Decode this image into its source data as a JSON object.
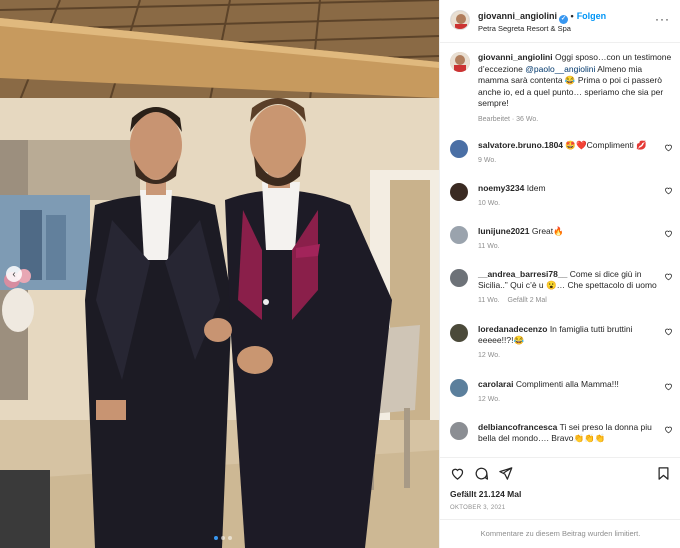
{
  "post": {
    "username": "giovanni_angiolini",
    "follow_label": "Folgen",
    "location": "Petra Segreta Resort & Spa",
    "more_icon": "more-options-icon",
    "caption": {
      "username": "giovanni_angiolini",
      "text_1": "Oggi sposo…con un testimone d’eccezione",
      "mention": "@paolo__angiolini",
      "text_2": "Almeno mia mamma sarà contenta 😂 Prima o poi ci passerò anche io, ed a quel punto… speriamo che sia per sempre!",
      "meta": "Bearbeitet · 36 Wo."
    },
    "comments": [
      {
        "username": "salvatore.bruno.1804",
        "text": "🤩❤️Complimenti 💋",
        "meta": "9 Wo.",
        "likes": ""
      },
      {
        "username": "noemy3234",
        "text": "Idem",
        "meta": "10 Wo.",
        "likes": ""
      },
      {
        "username": "lunijune2021",
        "text": "Great🔥",
        "meta": "11 Wo.",
        "likes": ""
      },
      {
        "username": "__andrea_barresi78__",
        "text": "Come si dice giù in Sicilia..” Qui c’è u 😮… Che spettacolo di uomo",
        "meta": "11 Wo.",
        "likes": "Gefällt 2 Mal"
      },
      {
        "username": "loredanadecenzo",
        "text": "In famiglia tutti bruttini eeeee!!?!😂",
        "meta": "12 Wo.",
        "likes": ""
      },
      {
        "username": "carolarai",
        "text": "Complimenti alla Mamma!!!",
        "meta": "12 Wo.",
        "likes": ""
      },
      {
        "username": "delbiancofrancesca",
        "text": "Ti sei preso la donna piu bella del mondo…. Bravo👏👏👏",
        "meta": "",
        "likes": ""
      }
    ],
    "likes_text": "Gefällt 21.124 Mal",
    "date": "OKTOBER 3, 2021",
    "comments_limited": "Kommentare zu diesem Beitrag wurden limitiert."
  },
  "colors": {
    "accent": "#0095f6",
    "verified": "#3897f0",
    "muted": "#8e8e8e"
  }
}
